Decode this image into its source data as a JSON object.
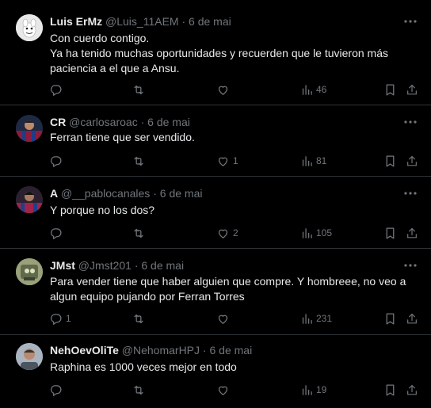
{
  "tweets": [
    {
      "name": "Luis ErMz",
      "handle": "@Luis_11AEM",
      "separator": "·",
      "date": "6 de mai",
      "lines": [
        "Con cuerdo contigo.",
        "Ya ha tenido muchas oportunidades y recuerden que le tuvieron más",
        "paciencia a el que a Ansu."
      ],
      "replies": "",
      "likes": "",
      "views": "46",
      "avatar_color": "#d9d9d9"
    },
    {
      "name": "CR",
      "handle": "@carlosaroac",
      "separator": "·",
      "date": "6 de mai",
      "lines": [
        "Ferran tiene que ser vendido."
      ],
      "replies": "",
      "likes": "1",
      "views": "81",
      "avatar_color": "#7a1f3a"
    },
    {
      "name": "A",
      "handle": "@__pablocanales",
      "separator": "·",
      "date": "6 de mai",
      "lines": [
        "Y porque no los dos?"
      ],
      "replies": "",
      "likes": "2",
      "views": "105",
      "avatar_color": "#9a2b4e"
    },
    {
      "name": "JMst",
      "handle": "@Jmst201",
      "separator": "·",
      "date": "6 de mai",
      "lines": [
        "Para vender tiene que haber alguien que compre. Y hombreee, no veo a",
        "algun equipo pujando por Ferran Torres"
      ],
      "replies": "1",
      "likes": "",
      "views": "231",
      "avatar_color": "#8a8f6a"
    },
    {
      "name": "NehOevOliTe",
      "handle": "@NehomarHPJ",
      "separator": "·",
      "date": "6 de mai",
      "lines": [
        "Raphina es 1000 veces mejor en todo"
      ],
      "replies": "",
      "likes": "",
      "views": "19",
      "avatar_color": "#7d8a99"
    }
  ]
}
